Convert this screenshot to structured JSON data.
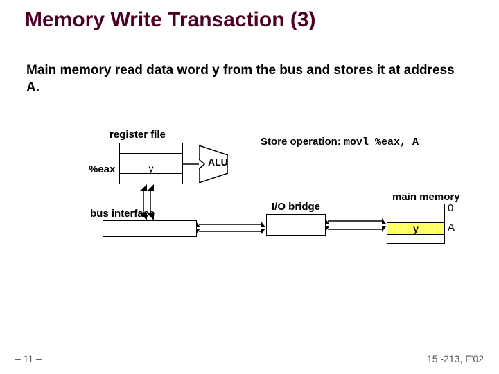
{
  "title": "Memory Write Transaction (3)",
  "subtitle": "Main memory read data word y from the bus and stores it at address A.",
  "regfile_label": "register file",
  "eax_label": "%eax",
  "regfile_value": "y",
  "alu_label": "ALU",
  "store_op_prefix": "Store operation: ",
  "store_op_code": "movl %eax, A",
  "io_bridge_label": "I/O bridge",
  "bus_interface_label": "bus interface",
  "main_memory_label": "main memory",
  "memory_addr0": "0",
  "memory_valueA": "y",
  "memory_addrA": "A",
  "footer_left": "– 11 –",
  "footer_right": "15 -213, F'02"
}
